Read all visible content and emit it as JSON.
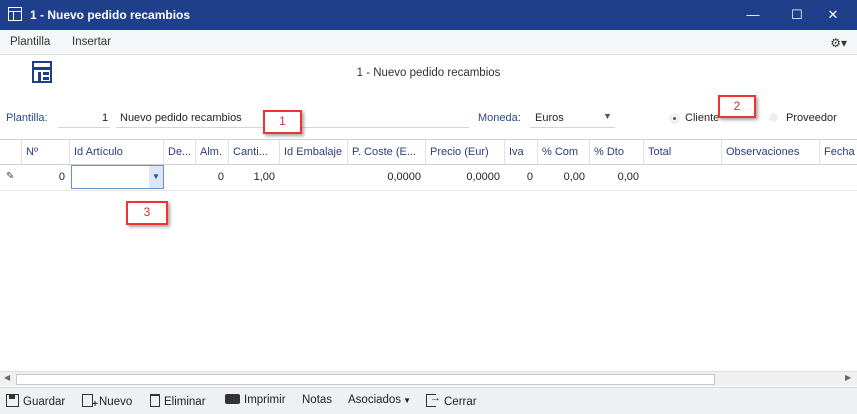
{
  "window": {
    "title": "1 - Nuevo pedido recambios"
  },
  "menu": {
    "items": [
      "Plantilla",
      "Insertar"
    ]
  },
  "header": {
    "center_title": "1 - Nuevo pedido recambios",
    "plantilla_label": "Plantilla:",
    "plantilla_number": "1",
    "plantilla_name": "Nuevo pedido recambios",
    "moneda_label": "Moneda:",
    "moneda_value": "Euros",
    "radio_cliente": "Cliente",
    "radio_proveedor": "Proveedor"
  },
  "callouts": [
    "1",
    "2",
    "3"
  ],
  "grid": {
    "columns": [
      "Nº",
      "Id Artículo",
      "De...",
      "Alm.",
      "Canti...",
      "Id Embalaje",
      "P. Coste (E...",
      "Precio (Eur)",
      "Iva",
      "% Com",
      "% Dto",
      "Total",
      "Observaciones",
      "Fecha"
    ],
    "row": {
      "n": "0",
      "id_articulo": "",
      "de": "",
      "alm": "0",
      "cantidad": "1,00",
      "id_embalaje": "",
      "p_coste": "0,0000",
      "precio": "0,0000",
      "iva": "0",
      "com": "0,00",
      "dto": "0,00",
      "total": "",
      "observaciones": "",
      "fecha": ""
    }
  },
  "toolbar": {
    "guardar": "Guardar",
    "nuevo": "Nuevo",
    "eliminar": "Eliminar",
    "imprimir": "Imprimir",
    "notas": "Notas",
    "asociados": "Asociados",
    "cerrar": "Cerrar"
  },
  "colors": {
    "titlebar": "#1f3f8a",
    "accent": "#2c4a8a",
    "callout": "#e33333"
  }
}
